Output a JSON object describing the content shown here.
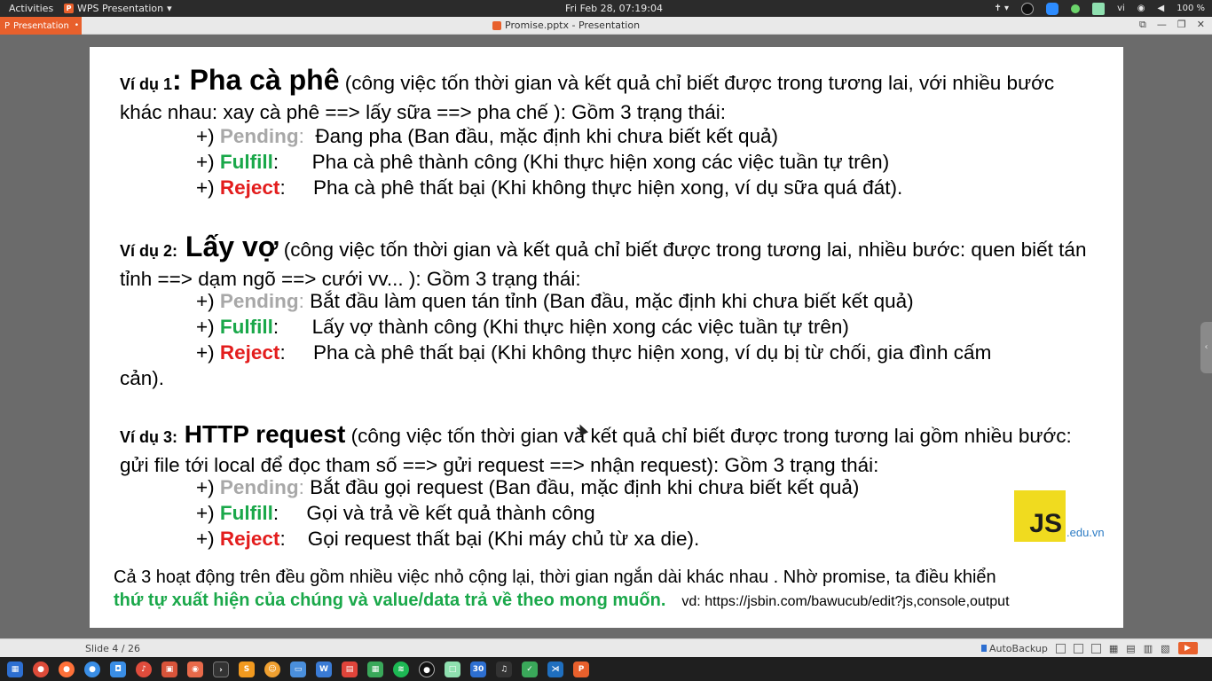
{
  "topbar": {
    "activities": "Activities",
    "app_name": "WPS Presentation",
    "clock": "Fri Feb 28, 07:19:04",
    "lang": "vi",
    "battery": "100 %"
  },
  "titlebar": {
    "app_tab": "Presentation",
    "doc_title": "Promise.pptx - Presentation"
  },
  "slide": {
    "ex1": {
      "label": "Ví dụ 1",
      "colon": ":",
      "title": " Pha cà phê",
      "desc": " (công việc tốn thời gian và kết quả chỉ biết được trong tương lai, với nhiều bước khác nhau: xay cà phê ==> lấy sữa ==> pha chế ): Gồm 3 trạng thái:",
      "pending": " Đang pha (Ban đầu, mặc định khi chưa biết kết quả)",
      "fulfill": " Pha cà phê thành công (Khi thực hiện xong các việc tuần tự trên)",
      "reject": " Pha cà phê thất bại (Khi không thực hiện xong, ví dụ sữa quá đát)."
    },
    "ex2": {
      "label": "Ví dụ 2:",
      "title": " Lấy vợ",
      "desc": " (công việc tốn thời gian và kết quả chỉ biết được trong tương lai, nhiều bước: quen biết tán tỉnh ==> dạm ngõ ==> cưới vv... ): Gồm 3 trạng thái:",
      "pending": " Bắt đầu làm quen tán tỉnh (Ban đầu, mặc định khi chưa biết kết quả)",
      "fulfill": " Lấy vợ thành công (Khi thực hiện xong các việc tuần tự trên)",
      "reject": " Pha cà phê thất bại (Khi không thực hiện xong, ví dụ bị từ chối, gia đình cấm",
      "reject_cont": "cản)."
    },
    "ex3": {
      "label": "Ví dụ 3:",
      "title": " HTTP request",
      "desc": " (công việc tốn thời gian và kết quả chỉ biết được trong tương lai gồm nhiều bước: gửi file tới local để đọc tham số ==> gửi request ==> nhận request): Gồm 3 trạng thái:",
      "pending": " Bắt đầu gọi request (Ban đầu, mặc định khi chưa biết kết quả)",
      "fulfill": " Gọi và trả về kết quả thành công",
      "reject": " Gọi request thất bại (Khi máy chủ từ xa die)."
    },
    "prefix": "+) ",
    "state_pending": "Pending",
    "state_fulfill": "Fulfill",
    "state_reject": "Reject",
    "state_colon": ":",
    "summary": "Cả 3 hoạt động trên đều gồm nhiều việc nhỏ cộng lại, thời gian ngắn dài khác nhau . Nhờ promise, ta điều khiển",
    "summary_green": "thứ tự xuất hiện của chúng và value/data trả về theo mong muốn",
    "summary_dot": ".",
    "summary_link": "vd: https://jsbin.com/bawucub/edit?js,console,output",
    "logo_text": "JS",
    "logo_suffix": ".edu.vn"
  },
  "statusbar": {
    "slide_no": "Slide 4 / 26",
    "autobackup": "AutoBackup"
  },
  "colors": {
    "accent": "#e8602c",
    "pending": "#a8a8a8",
    "fulfill": "#1aa84a",
    "reject": "#e31d1d"
  }
}
